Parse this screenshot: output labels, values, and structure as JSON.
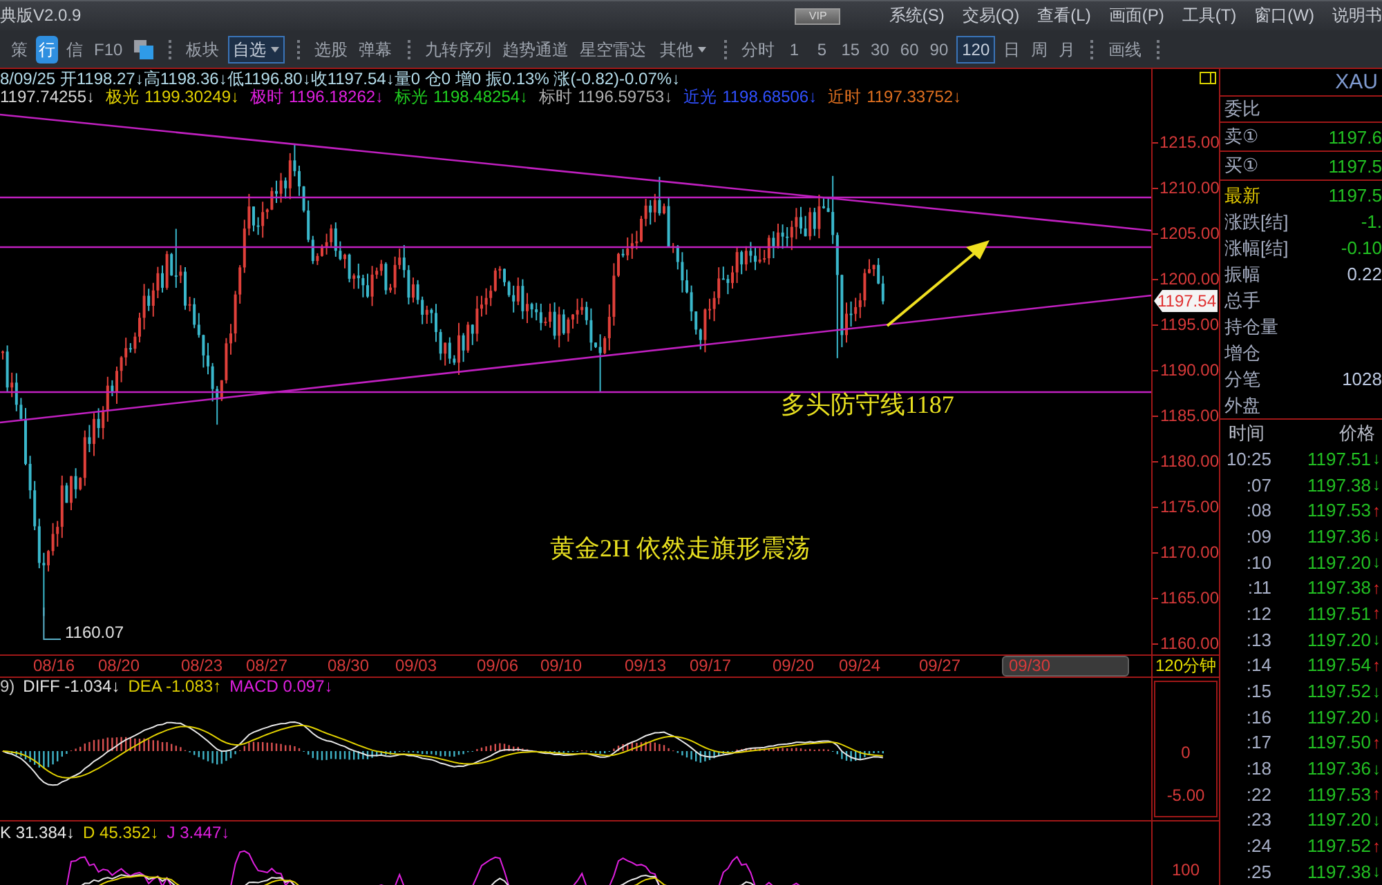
{
  "title_bar": {
    "title": "典版V2.0.9",
    "badge": "VIP",
    "menus": [
      "系统(S)",
      "交易(Q)",
      "查看(L)",
      "画面(P)",
      "工具(T)",
      "窗口(W)",
      "说明书"
    ]
  },
  "toolbar": {
    "groups": [
      {
        "items": [
          {
            "kind": "glyph",
            "label": "策",
            "selected": false
          },
          {
            "kind": "glyph",
            "label": "行",
            "selected": true
          },
          {
            "kind": "glyph",
            "label": "信",
            "selected": false
          },
          {
            "kind": "text",
            "label": "F10",
            "selected": false
          },
          {
            "kind": "icon",
            "selected": false
          }
        ]
      },
      {
        "items": [
          {
            "kind": "text",
            "label": "板块",
            "selected": false
          },
          {
            "kind": "dropdown",
            "label": "自选",
            "selected": true
          }
        ]
      },
      {
        "items": [
          {
            "kind": "text",
            "label": "选股",
            "selected": false
          },
          {
            "kind": "text",
            "label": "弹幕",
            "selected": false
          }
        ]
      },
      {
        "items": [
          {
            "kind": "text",
            "label": "九转序列",
            "selected": false
          },
          {
            "kind": "text",
            "label": "趋势通道",
            "selected": false
          },
          {
            "kind": "text",
            "label": "星空雷达",
            "selected": false
          },
          {
            "kind": "dropdown",
            "label": "其他",
            "selected": false
          }
        ]
      },
      {
        "items": [
          {
            "kind": "text",
            "label": "分时",
            "selected": false
          },
          {
            "kind": "text",
            "label": "1",
            "selected": false
          },
          {
            "kind": "text",
            "label": "5",
            "selected": false
          },
          {
            "kind": "text",
            "label": "15",
            "selected": false
          },
          {
            "kind": "text",
            "label": "30",
            "selected": false
          },
          {
            "kind": "text",
            "label": "60",
            "selected": false
          },
          {
            "kind": "text",
            "label": "90",
            "selected": false
          },
          {
            "kind": "text",
            "label": "120",
            "selected": true
          },
          {
            "kind": "text",
            "label": "日",
            "selected": false
          },
          {
            "kind": "text",
            "label": "周",
            "selected": false
          },
          {
            "kind": "text",
            "label": "月",
            "selected": false
          }
        ]
      },
      {
        "items": [
          {
            "kind": "text",
            "label": "画线",
            "selected": false
          }
        ]
      }
    ]
  },
  "chart": {
    "ohlc": "8/09/25 开1198.27↓高1198.36↓低1196.80↓收1197.54↓量0 仓0 增0 振0.13% 涨(-0.82)-0.07%↓",
    "indicators": [
      {
        "value": "1197.74255↓",
        "color": "#d8d8d8"
      },
      {
        "label": "极光",
        "value": "1199.30249↓",
        "color": "#e0d000"
      },
      {
        "label": "极时",
        "value": "1196.18262↓",
        "color": "#e020e0"
      },
      {
        "label": "标光",
        "value": "1198.48254↓",
        "color": "#20d020"
      },
      {
        "label": "标时",
        "value": "1196.59753↓",
        "color": "#b0b0b0"
      },
      {
        "label": "近光",
        "value": "1198.68506↓",
        "color": "#3050ff"
      },
      {
        "label": "近时",
        "value": "1197.33752↓",
        "color": "#e07020"
      }
    ],
    "price_ticks": [
      "1215.00",
      "1210.00",
      "1205.00",
      "1200.00",
      "1195.00",
      "1190.00",
      "1185.00",
      "1180.00",
      "1175.00",
      "1170.00",
      "1165.00",
      "1160.00"
    ],
    "last_price": "1197.54",
    "low_marker": "1160.07",
    "annotations": [
      "多头防守线1187",
      "黄金2H 依然走旗形震荡"
    ],
    "dates": [
      {
        "label": "08/16",
        "highlighted": false
      },
      {
        "label": "08/20",
        "highlighted": false
      },
      {
        "label": "08/23",
        "highlighted": false
      },
      {
        "label": "08/27",
        "highlighted": false
      },
      {
        "label": "08/30",
        "highlighted": false
      },
      {
        "label": "09/03",
        "highlighted": false
      },
      {
        "label": "09/06",
        "highlighted": false
      },
      {
        "label": "09/10",
        "highlighted": false
      },
      {
        "label": "09/13",
        "highlighted": false
      },
      {
        "label": "09/17",
        "highlighted": false
      },
      {
        "label": "09/20",
        "highlighted": false
      },
      {
        "label": "09/24",
        "highlighted": false
      },
      {
        "label": "09/27",
        "highlighted": false
      },
      {
        "label": "09/30",
        "highlighted": true
      }
    ],
    "period_label": "120分钟"
  },
  "macd": {
    "legend": [
      {
        "text": "9)",
        "color": "#c8c8c8"
      },
      {
        "text": "DIFF -1.034↓",
        "color": "#e8e8e8"
      },
      {
        "text": "DEA -1.083↑",
        "color": "#e0d000"
      },
      {
        "text": "MACD 0.097↓",
        "color": "#e020e0"
      }
    ],
    "ticks": [
      "0",
      "-5.00"
    ]
  },
  "kdj": {
    "legend": [
      {
        "text": "K 31.384↓",
        "color": "#e8e8e8"
      },
      {
        "text": "D 45.352↓",
        "color": "#e0d000"
      },
      {
        "text": "J 3.447↓",
        "color": "#e020e0"
      }
    ],
    "ticks": [
      "100"
    ]
  },
  "quote": {
    "symbol": "XAU",
    "ratio_label": "委比",
    "book": [
      {
        "label": "卖①",
        "value": "1197.6"
      },
      {
        "label": "买①",
        "value": "1197.5"
      }
    ],
    "stats": [
      {
        "label": "最新",
        "value": "1197.5",
        "highlight": true,
        "kind": "down"
      },
      {
        "label": "涨跌[结]",
        "value": "-1.",
        "highlight": false,
        "kind": "down"
      },
      {
        "label": "涨幅[结]",
        "value": "-0.10",
        "highlight": false,
        "kind": "down"
      },
      {
        "label": "振幅",
        "value": "0.22",
        "highlight": false,
        "kind": "flat"
      },
      {
        "label": "总手",
        "highlight": false
      },
      {
        "label": "持仓量",
        "highlight": false
      },
      {
        "label": "增仓",
        "highlight": false
      },
      {
        "label": "分笔",
        "value": "1028",
        "highlight": false,
        "kind": "flat"
      },
      {
        "label": "外盘",
        "highlight": false
      }
    ]
  },
  "trades": {
    "columns": [
      "时间",
      "价格"
    ],
    "rows": [
      {
        "time": "10:25",
        "price": "1197.51",
        "arrow": "↓",
        "kind": "down"
      },
      {
        "time": ":07",
        "price": "1197.38",
        "arrow": "↓",
        "kind": "down"
      },
      {
        "time": ":08",
        "price": "1197.53",
        "arrow": "↑",
        "kind": "up"
      },
      {
        "time": ":09",
        "price": "1197.36",
        "arrow": "↓",
        "kind": "down"
      },
      {
        "time": ":10",
        "price": "1197.20",
        "arrow": "↓",
        "kind": "down"
      },
      {
        "time": ":11",
        "price": "1197.38",
        "arrow": "↑",
        "kind": "up"
      },
      {
        "time": ":12",
        "price": "1197.51",
        "arrow": "↑",
        "kind": "up"
      },
      {
        "time": ":13",
        "price": "1197.20",
        "arrow": "↓",
        "kind": "down"
      },
      {
        "time": ":14",
        "price": "1197.54",
        "arrow": "↑",
        "kind": "up"
      },
      {
        "time": ":15",
        "price": "1197.52",
        "arrow": "↓",
        "kind": "down"
      },
      {
        "time": ":16",
        "price": "1197.20",
        "arrow": "↓",
        "kind": "down"
      },
      {
        "time": ":17",
        "price": "1197.50",
        "arrow": "↑",
        "kind": "up"
      },
      {
        "time": ":18",
        "price": "1197.36",
        "arrow": "↓",
        "kind": "down"
      },
      {
        "time": ":22",
        "price": "1197.53",
        "arrow": "↑",
        "kind": "up"
      },
      {
        "time": ":23",
        "price": "1197.20",
        "arrow": "↓",
        "kind": "down"
      },
      {
        "time": ":24",
        "price": "1197.52",
        "arrow": "↑",
        "kind": "up"
      },
      {
        "time": ":25",
        "price": "1197.38",
        "arrow": "↓",
        "kind": "down"
      }
    ]
  }
}
